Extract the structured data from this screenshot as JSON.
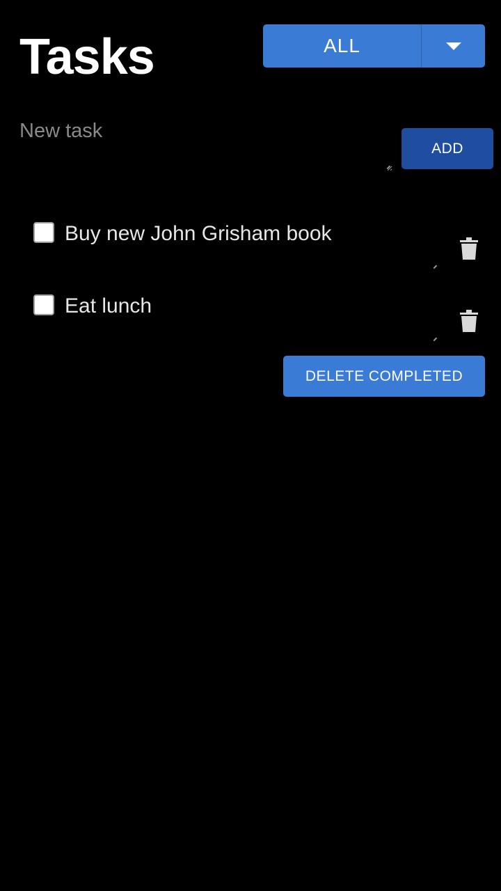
{
  "header": {
    "title": "Tasks"
  },
  "filter": {
    "selected": "ALL",
    "toggle_icon": "caret-down-icon"
  },
  "new_task": {
    "placeholder": "New task",
    "value": ""
  },
  "add_button": {
    "label": "ADD"
  },
  "tasks": [
    {
      "text": "Buy new John Grisham book",
      "completed": false
    },
    {
      "text": "Eat lunch",
      "completed": false
    }
  ],
  "delete_completed": {
    "label": "DELETE COMPLETED"
  },
  "colors": {
    "background": "#000000",
    "primary": "#3a7bd5",
    "primary_dark": "#1f4ea1",
    "text": "#ffffff",
    "placeholder": "#8a8a8a"
  },
  "icons": {
    "delete_task": "trash-icon"
  }
}
